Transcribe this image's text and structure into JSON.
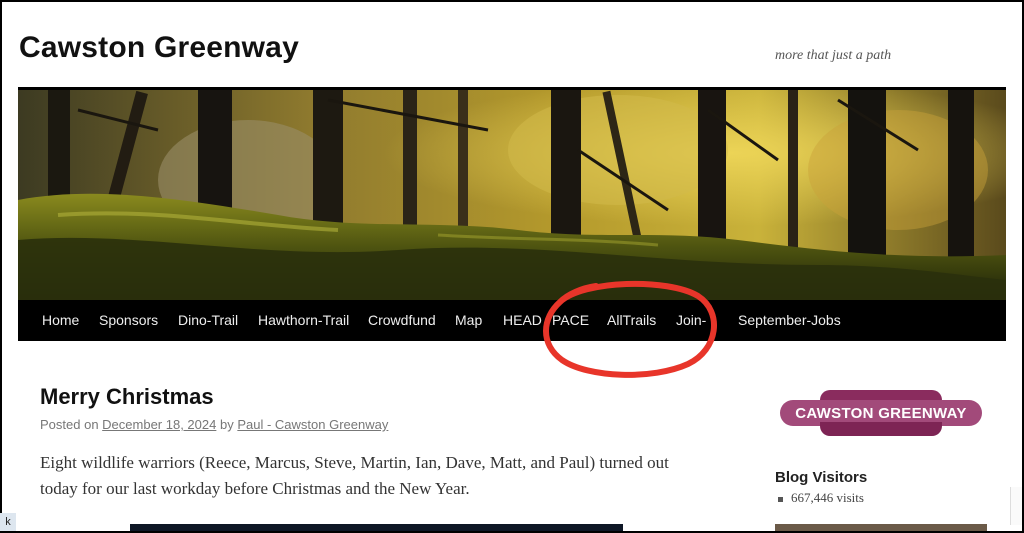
{
  "site": {
    "title": "Cawston Greenway",
    "tagline": "more that just a path"
  },
  "nav": {
    "items": [
      "Home",
      "Sponsors",
      "Dino-Trail",
      "Hawthorn-Trail",
      "Crowdfund",
      "Map",
      "HEADSPACE",
      "AllTrails",
      "Join-Us",
      "September-Jobs"
    ],
    "visible_labels": [
      "Home",
      "Sponsors",
      "Dino-Trail",
      "Hawthorn-Trail",
      "Crowdfund",
      "Map",
      "HEAD",
      "PACE",
      "AllTrails",
      "Join-",
      "September-Jobs"
    ]
  },
  "annotation": {
    "shape": "hand-drawn-circle",
    "color": "#e8352a",
    "highlights": "AllTrails"
  },
  "post": {
    "title": "Merry Christmas",
    "posted_on_label": "Posted on",
    "date": "December 18, 2024",
    "by_label": "by",
    "author": "Paul - Cawston Greenway",
    "body": "Eight wildlife warriors (Reece, Marcus, Steve, Martin, Ian, Dave, Matt, and Paul) turned out today for our last workday before Christmas and the New Year."
  },
  "sidebar": {
    "badge_text": "CAWSTON GREENWAY",
    "badge_color": "#a24a7a",
    "widget_title": "Blog Visitors",
    "visits": "667,446 visits"
  },
  "corner": {
    "label": "k"
  },
  "colors": {
    "nav_bg": "#000000",
    "link": "#777777",
    "annotation": "#e8352a"
  }
}
